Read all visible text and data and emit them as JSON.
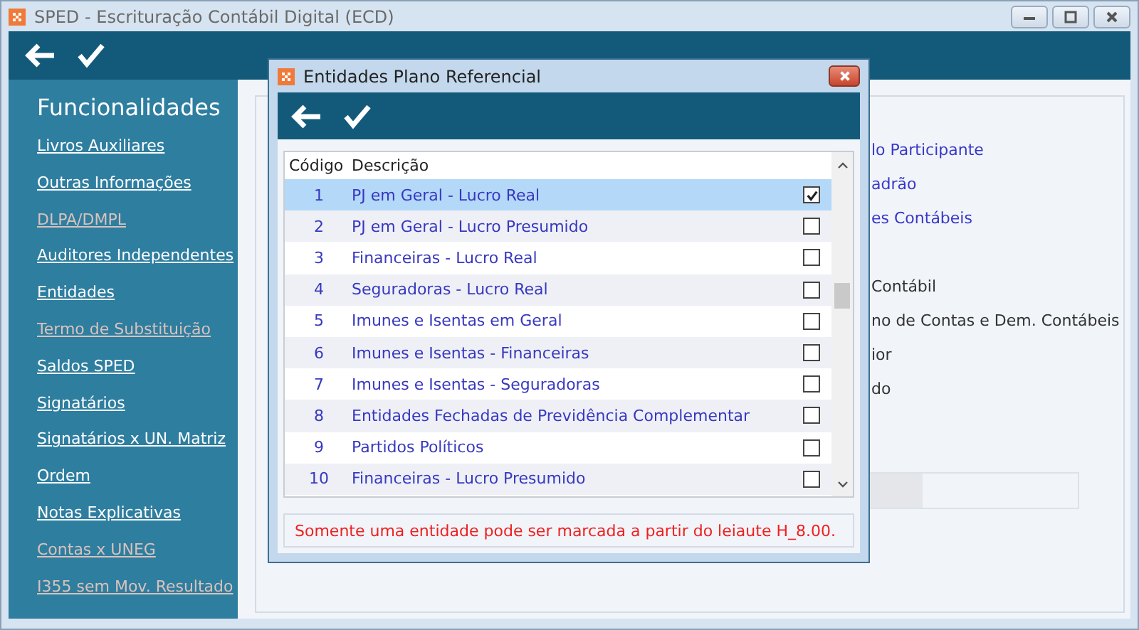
{
  "window": {
    "title": "SPED - Escrituração Contábil Digital (ECD)"
  },
  "sidebar": {
    "title": "Funcionalidades",
    "items": [
      {
        "label": "Livros Auxiliares",
        "disabled": false
      },
      {
        "label": "Outras Informações",
        "disabled": false
      },
      {
        "label": "DLPA/DMPL",
        "disabled": true
      },
      {
        "label": "Auditores Independentes",
        "disabled": false
      },
      {
        "label": "Entidades",
        "disabled": false
      },
      {
        "label": "Termo de Substituição",
        "disabled": true
      },
      {
        "label": "Saldos SPED",
        "disabled": false
      },
      {
        "label": "Signatários",
        "disabled": false
      },
      {
        "label": "Signatários x UN. Matriz",
        "disabled": false
      },
      {
        "label": "Ordem",
        "disabled": false
      },
      {
        "label": "Notas Explicativas",
        "disabled": false
      },
      {
        "label": "Contas x UNEG",
        "disabled": true
      },
      {
        "label": "I355 sem Mov. Resultado",
        "disabled": true
      }
    ]
  },
  "background_groups": [
    [
      {
        "label": "lo Participante",
        "kind": "link"
      },
      {
        "label": "adrão",
        "kind": "link"
      },
      {
        "label": "es Contábeis",
        "kind": "link"
      }
    ],
    [
      {
        "label": "Contábil",
        "kind": "text"
      },
      {
        "label": "no de Contas e Dem. Contábeis",
        "kind": "text"
      },
      {
        "label": "ior",
        "kind": "text"
      },
      {
        "label": "do",
        "kind": "text"
      }
    ]
  ],
  "progress": {
    "level": 0.3
  },
  "dialog": {
    "title": "Entidades Plano Referencial",
    "columns": [
      "Código",
      "Descrição"
    ],
    "rows": [
      {
        "code": "1",
        "description": "PJ em Geral - Lucro Real",
        "selected": true,
        "checked": true
      },
      {
        "code": "2",
        "description": "PJ em Geral - Lucro Presumido",
        "selected": false,
        "checked": false
      },
      {
        "code": "3",
        "description": "Financeiras - Lucro Real",
        "selected": false,
        "checked": false
      },
      {
        "code": "4",
        "description": "Seguradoras - Lucro Real",
        "selected": false,
        "checked": false
      },
      {
        "code": "5",
        "description": "Imunes e Isentas em Geral",
        "selected": false,
        "checked": false
      },
      {
        "code": "6",
        "description": "Imunes e Isentas - Financeiras",
        "selected": false,
        "checked": false
      },
      {
        "code": "7",
        "description": "Imunes e Isentas - Seguradoras",
        "selected": false,
        "checked": false
      },
      {
        "code": "8",
        "description": "Entidades Fechadas de Previdência Complementar",
        "selected": false,
        "checked": false
      },
      {
        "code": "9",
        "description": "Partidos Políticos",
        "selected": false,
        "checked": false
      },
      {
        "code": "10",
        "description": "Financeiras - Lucro Presumido",
        "selected": false,
        "checked": false
      }
    ],
    "message": "Somente uma entidade pode ser marcada a partir do leiaute H_8.00."
  }
}
